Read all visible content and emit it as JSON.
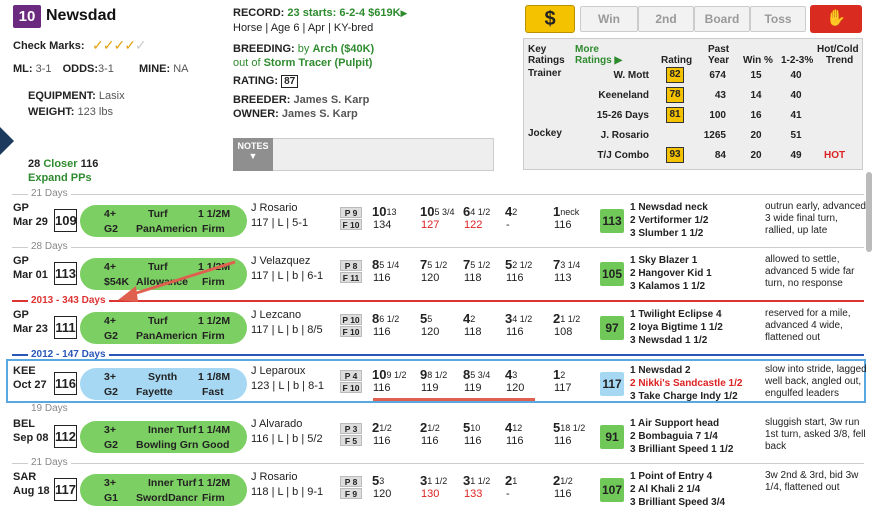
{
  "horse": {
    "number": "10",
    "name": "Newsdad",
    "checkmarks_label": "Check Marks:",
    "checkmarks": "✓✓✓✓",
    "checkmarks_faded": "✓",
    "ml_label": "ML:",
    "ml": "3-1",
    "odds_label": "ODDS:",
    "odds": "3-1",
    "mine_label": "MINE:",
    "mine": "NA",
    "equipment_label": "EQUIPMENT:",
    "equipment": "Lasix",
    "weight_label": "WEIGHT:",
    "weight": "123 lbs",
    "closer_num": "28",
    "closer_label": "Closer",
    "closer_val": "116",
    "expand": "Expand PPs"
  },
  "info": {
    "record_label": "RECORD:",
    "record": "23 starts: 6-2-4 $619K",
    "record_arrow": "▶",
    "details": "Horse | Age 6 | Apr | KY-bred",
    "breeding_label": "BREEDING:",
    "sire_prefix": "by",
    "sire": "Arch ($40K)",
    "dam_prefix": "out of",
    "dam": "Storm Tracer (Pulpit)",
    "rating_label": "RATING:",
    "rating": "87",
    "breeder_label": "BREEDER:",
    "breeder": "James S. Karp",
    "owner_label": "OWNER:",
    "owner": "James S. Karp"
  },
  "buttons": {
    "dollar": "$",
    "win": "Win",
    "second": "2nd",
    "board": "Board",
    "toss": "Toss",
    "thumb": "✋"
  },
  "notes": {
    "label": "NOTES",
    "arrow": "▼"
  },
  "stats": {
    "h_key": "Key",
    "h_key2": "Ratings",
    "h_more": "More",
    "h_more2": "Ratings ▶",
    "h_rating": "Rating",
    "h_past": "Past",
    "h_past2": "Year",
    "h_win": "Win %",
    "h_123": "1-2-3%",
    "h_hot": "Hot/Cold",
    "h_trend": "Trend",
    "rows": [
      {
        "group": "Trainer",
        "name": "W. Mott",
        "rating": "82",
        "past": "674",
        "win": "15",
        "t123": "40",
        "trend": ""
      },
      {
        "group": "",
        "name": "Keeneland",
        "rating": "78",
        "past": "43",
        "win": "14",
        "t123": "40",
        "trend": ""
      },
      {
        "group": "",
        "name": "15-26 Days",
        "rating": "81",
        "past": "100",
        "win": "16",
        "t123": "41",
        "trend": ""
      },
      {
        "group": "Jockey",
        "name": "J. Rosario",
        "rating": "",
        "past": "1265",
        "win": "20",
        "t123": "51",
        "trend": ""
      },
      {
        "group": "",
        "name": "T/J Combo",
        "rating": "93",
        "past": "84",
        "win": "20",
        "t123": "49",
        "trend": "HOT"
      }
    ]
  },
  "dividers": {
    "d1": "21 Days",
    "d2": "28 Days",
    "y1": "2013 - 343 Days",
    "y2": "2012 - 147 Days",
    "d3": "19 Days",
    "d4": "21 Days"
  },
  "races": [
    {
      "track": "GP",
      "date": "Mar 29",
      "speed": "109",
      "age": "4+",
      "surface": "Turf",
      "dist": "1 1/2M",
      "cls": "G2",
      "race": "PanAmericn",
      "cond": "Firm",
      "jockey": "J Rosario",
      "jline": "117 | L | 5-1",
      "p": "P 9",
      "f": "F 10",
      "c1a": "10",
      "c1s": "13",
      "c1b": "134",
      "c2a": "10",
      "c2s": "5 3/4",
      "c2b": "127",
      "c3a": "6",
      "c3s": "4 1/2",
      "c3b": "122",
      "c4a": "4",
      "c4s": "2",
      "c4b": "-",
      "c5a": "1",
      "c5s": "neck",
      "c5b": "116",
      "fig": "113",
      "o1": "1 Newsdad  neck",
      "o2": "2 Vertiformer  1/2",
      "o3": "3 Slumber  1 1/2",
      "cmt": "outrun early, advanced 3 wide final turn, rallied, up late"
    },
    {
      "track": "GP",
      "date": "Mar 01",
      "speed": "113",
      "age": "4+",
      "surface": "Turf",
      "dist": "1 1/2M",
      "cls": "$54K",
      "race": "Allowance",
      "cond": "Firm",
      "jockey": "J Velazquez",
      "jline": "117 | L | b | 6-1",
      "p": "P 8",
      "f": "F 11",
      "c1a": "8",
      "c1s": "5 1/4",
      "c1b": "116",
      "c2a": "7",
      "c2s": "5 1/2",
      "c2b": "120",
      "c3a": "7",
      "c3s": "5 1/2",
      "c3b": "118",
      "c4a": "5",
      "c4s": "2 1/2",
      "c4b": "116",
      "c5a": "7",
      "c5s": "3 1/4",
      "c5b": "113",
      "fig": "105",
      "o1": "1 Sky Blazer  1",
      "o2": "2 Hangover Kid  1",
      "o3": "3 Kalamos  1 1/2",
      "cmt": "allowed to settle, advanced 5 wide far turn, no response"
    },
    {
      "track": "GP",
      "date": "Mar 23",
      "speed": "111",
      "age": "4+",
      "surface": "Turf",
      "dist": "1 1/2M",
      "cls": "G2",
      "race": "PanAmericn",
      "cond": "Firm",
      "jockey": "J Lezcano",
      "jline": "117 | L | b | 8/5",
      "p": "P 10",
      "f": "F 10",
      "c1a": "8",
      "c1s": "6 1/2",
      "c1b": "116",
      "c2a": "5",
      "c2s": "5",
      "c2b": "120",
      "c3a": "4",
      "c3s": "2",
      "c3b": "118",
      "c4a": "3",
      "c4s": "4 1/2",
      "c4b": "116",
      "c5a": "2",
      "c5s": "1 1/2",
      "c5b": "108",
      "fig": "97",
      "o1": "1 Twilight Eclipse  4",
      "o2": "2 Ioya Bigtime  1 1/2",
      "o3": "3 Newsdad  1 1/2",
      "cmt": "reserved for a mile, advanced 4 wide, flattened out"
    },
    {
      "track": "KEE",
      "date": "Oct 27",
      "speed": "116",
      "age": "3+",
      "surface": "Synth",
      "dist": "1 1/8M",
      "cls": "G2",
      "race": "Fayette",
      "cond": "Fast",
      "jockey": "J Leparoux",
      "jline": "123 | L | b | 8-1",
      "p": "P 4",
      "f": "F 10",
      "c1a": "10",
      "c1s": "9 1/2",
      "c1b": "116",
      "c2a": "9",
      "c2s": "8 1/2",
      "c2b": "119",
      "c3a": "8",
      "c3s": "5 3/4",
      "c3b": "119",
      "c4a": "4",
      "c4s": "3",
      "c4b": "120",
      "c5a": "1",
      "c5s": "2",
      "c5b": "117",
      "fig": "117",
      "o1": "1 Newsdad  2",
      "o2": "2 Nikki's Sandcastle  1/2",
      "o3": "3 Take Charge Indy  1/2",
      "cmt": "slow into stride, lagged well back, angled out, engulfed leaders"
    },
    {
      "track": "BEL",
      "date": "Sep 08",
      "speed": "112",
      "age": "3+",
      "surface": "Inner Turf",
      "dist": "1 1/4M",
      "cls": "G2",
      "race": "Bowling Grn",
      "cond": "Good",
      "jockey": "J Alvarado",
      "jline": "116 | L | b | 5/2",
      "p": "P 3",
      "f": "F 5",
      "c1a": "2",
      "c1s": "1/2",
      "c1b": "116",
      "c2a": "2",
      "c2s": "1/2",
      "c2b": "116",
      "c3a": "5",
      "c3s": "10",
      "c3b": "116",
      "c4a": "4",
      "c4s": "12",
      "c4b": "116",
      "c5a": "5",
      "c5s": "18 1/2",
      "c5b": "116",
      "fig": "91",
      "o1": "1 Air Support  head",
      "o2": "2 Bombaguia  7 1/4",
      "o3": "3 Brilliant Speed  1 1/2",
      "cmt": "sluggish start, 3w run 1st turn, asked 3/8, fell back"
    },
    {
      "track": "SAR",
      "date": "Aug 18",
      "speed": "117",
      "age": "3+",
      "surface": "Inner Turf",
      "dist": "1 1/2M",
      "cls": "G1",
      "race": "SwordDancr",
      "cond": "Firm",
      "jockey": "J Rosario",
      "jline": "118 | L | b | 9-1",
      "p": "P 8",
      "f": "F 9",
      "c1a": "5",
      "c1s": "3",
      "c1b": "120",
      "c2a": "3",
      "c2s": "1 1/2",
      "c2b": "130",
      "c3a": "3",
      "c3s": "1 1/2",
      "c3b": "133",
      "c4a": "2",
      "c4s": "1",
      "c4b": "-",
      "c5a": "2",
      "c5s": "1/2",
      "c5b": "116",
      "fig": "107",
      "o1": "1 Point of Entry  4",
      "o2": "2 Al Khali  2 1/4",
      "o3": "3 Brilliant Speed  3/4",
      "cmt": "3w 2nd & 3rd, bid 3w 1/4, flattened out"
    }
  ],
  "colors": {
    "green_pill": "#7ccf62",
    "blue_pill": "#a6d8f3",
    "select_border": "#5aa8e0",
    "year_red": "#d33",
    "year_blue": "#2a56b8",
    "arrow": "#e06050"
  }
}
